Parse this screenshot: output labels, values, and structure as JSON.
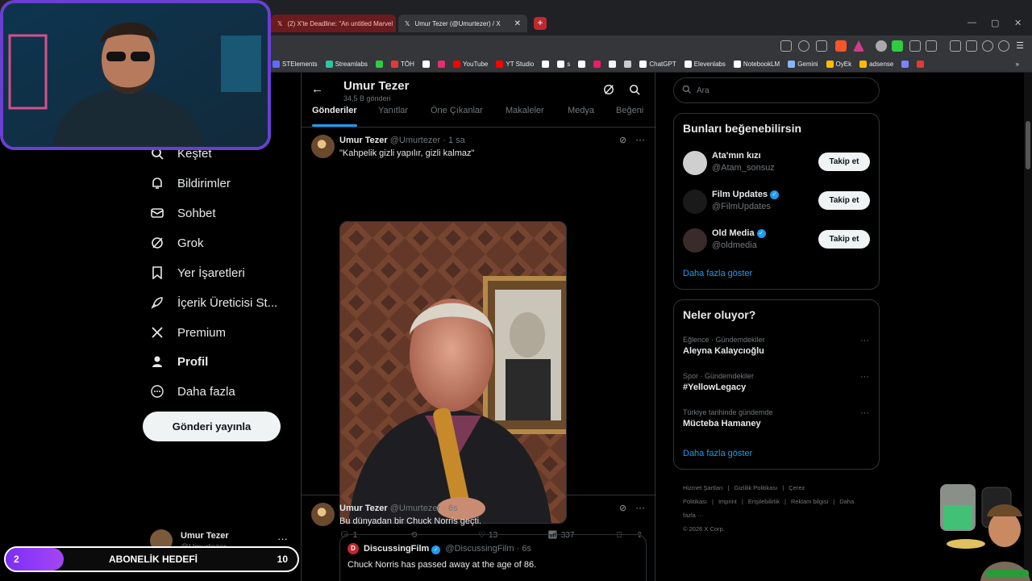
{
  "browser": {
    "tabs": [
      {
        "title": "(2) X'te Deadline: \"An untitled Marvel",
        "state": "background"
      },
      {
        "title": "Umur Tezer (@Umurtezer) / X",
        "state": "active"
      }
    ],
    "new_tab": "+",
    "tab_close": "✕",
    "window_controls": [
      "—",
      "▢",
      "✕"
    ],
    "bookmarks": [
      {
        "label": "STElements",
        "color": "#5b6cff"
      },
      {
        "label": "Streamlabs",
        "color": "#31c3a2"
      },
      {
        "label": "",
        "color": "#2ecc40"
      },
      {
        "label": "TÖH",
        "color": "#e53935"
      },
      {
        "label": "",
        "color": "#ffffff"
      },
      {
        "label": "",
        "color": "#e1306c"
      },
      {
        "label": "YouTube",
        "color": "#ff0000"
      },
      {
        "label": "YT Studio",
        "color": "#ff0000"
      },
      {
        "label": "",
        "color": "#ffffff"
      },
      {
        "label": "s",
        "color": "#ffffff"
      },
      {
        "label": "",
        "color": "#ffffff"
      },
      {
        "label": "",
        "color": "#e91e63"
      },
      {
        "label": "",
        "color": "#f5f5f5"
      },
      {
        "label": "",
        "color": "#cccccc"
      },
      {
        "label": "ChatGPT",
        "color": "#ffffff"
      },
      {
        "label": "Elevenlabs",
        "color": "#ffffff"
      },
      {
        "label": "NotebookLM",
        "color": "#ffffff"
      },
      {
        "label": "Gemini",
        "color": "#8ab4f8"
      },
      {
        "label": "OyEk",
        "color": "#fbbc04"
      },
      {
        "label": "adsense",
        "color": "#fbbc04"
      },
      {
        "label": "",
        "color": "#7c83ff"
      },
      {
        "label": "",
        "color": "#e53935"
      }
    ],
    "bookmarks_overflow": "»"
  },
  "nav": {
    "items": [
      {
        "label": "Keşfet",
        "icon": "search-icon"
      },
      {
        "label": "Bildirimler",
        "icon": "bell-icon"
      },
      {
        "label": "Sohbet",
        "icon": "mail-icon"
      },
      {
        "label": "Grok",
        "icon": "grok-icon"
      },
      {
        "label": "Yer İşaretleri",
        "icon": "bookmark-icon"
      },
      {
        "label": "İçerik Üreticisi St...",
        "icon": "rocket-icon"
      },
      {
        "label": "Premium",
        "icon": "x-logo-icon"
      },
      {
        "label": "Profil",
        "icon": "person-icon"
      },
      {
        "label": "Daha fazla",
        "icon": "more-circle-icon"
      }
    ],
    "post_button": "Gönderi yayınla",
    "account": {
      "name": "Umur Tezer",
      "handle": "@Umurtezer",
      "more": "···"
    }
  },
  "profile": {
    "name": "Umur Tezer",
    "post_count": "34,5 B gönderi",
    "back": "←",
    "tabs": [
      "Gönderiler",
      "Yanıtlar",
      "Öne Çıkanlar",
      "Makaleler",
      "Medya",
      "Beğeni"
    ],
    "active_tab": "Gönderiler"
  },
  "tweets": [
    {
      "name": "Umur Tezer",
      "handle": "@Umurtezer · 1 sa",
      "text": "\"Kahpelik gizli yapılır, gizli kalmaz\"",
      "replies": "1",
      "likes": "13",
      "views": "337"
    },
    {
      "name": "Umur Tezer",
      "handle": "@Umurtezer · 6s",
      "text": "Bu dünyadan bir Chuck Norris geçti.",
      "quote": {
        "name": "DiscussingFilm",
        "handle": "@DiscussingFilm · 6s",
        "text": "Chuck Norris has passed away at the age of 86."
      }
    }
  ],
  "sidebar": {
    "search_placeholder": "Ara",
    "who_to_follow": {
      "title": "Bunları beğenebilirsin",
      "users": [
        {
          "name": "Ata'mın kızı",
          "handle": "@Atam_sonsuz",
          "verified": false,
          "follow": "Takip et",
          "avatar_color": "#cfcfcf"
        },
        {
          "name": "Film Updates",
          "handle": "@FilmUpdates",
          "verified": true,
          "follow": "Takip et",
          "avatar_color": "#1a1a1a"
        },
        {
          "name": "Old Media",
          "handle": "@oldmedia",
          "verified": true,
          "follow": "Takip et",
          "avatar_color": "#3a2a2a"
        }
      ],
      "show_more": "Daha fazla göster"
    },
    "trends": {
      "title": "Neler oluyor?",
      "items": [
        {
          "meta": "Eğlence · Gündemdekiler",
          "topic": "Aleyna Kalaycıoğlu"
        },
        {
          "meta": "Spor · Gündemdekiler",
          "topic": "#YellowLegacy"
        },
        {
          "meta": "Türkiye tarihinde gündemde",
          "topic": "Mücteba Hamaney"
        }
      ],
      "show_more": "Daha fazla göster"
    },
    "footer": [
      "Hizmet Şartları",
      "|",
      "Gizlilik Politikası",
      "|",
      "Çerez Politikası",
      "|",
      "Imprint",
      "|",
      "Erişilebilirlik",
      "|",
      "Reklam bilgisi",
      "|",
      "Daha fazla ···",
      "© 2026 X Corp."
    ]
  },
  "goal": {
    "current": "2",
    "label": "ABONELİK HEDEFİ",
    "target": "10",
    "progress": 0.2
  },
  "colors": {
    "accent": "#1d9bf0",
    "goal_fill": "#8b3bf5",
    "webcam_border": "#6a3fd1"
  }
}
